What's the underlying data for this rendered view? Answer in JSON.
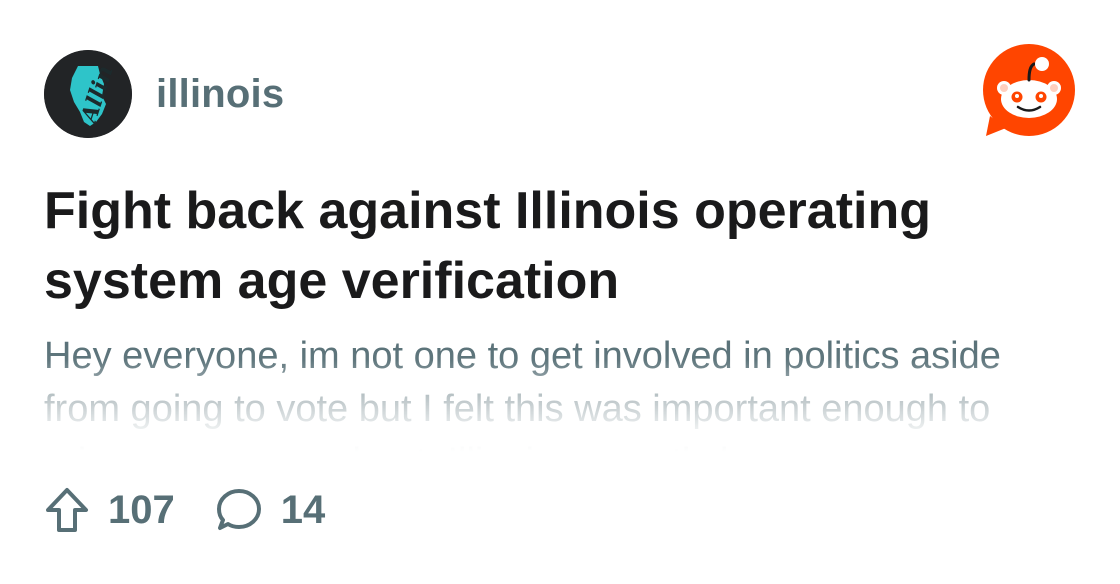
{
  "subreddit": {
    "name": "illinois",
    "avatar_icon": "illinois-state-icon",
    "avatar_text": "Allin"
  },
  "brand": {
    "logo_icon": "reddit-snoo-icon",
    "color": "#ff4500"
  },
  "post": {
    "title": "Fight back against Illinois operating system age verification",
    "body": "Hey everyone, im not one to get involved in politics aside from going to vote but I felt this was important enough to raise awareness about. Illinois currently has"
  },
  "stats": {
    "upvote_icon": "upvote-arrow-icon",
    "upvotes": "107",
    "comment_icon": "comment-bubble-icon",
    "comments": "14"
  },
  "colors": {
    "title": "#1a1a1b",
    "muted": "#576f76",
    "avatar_bg": "#222426",
    "avatar_accent": "#2ec4c9"
  }
}
